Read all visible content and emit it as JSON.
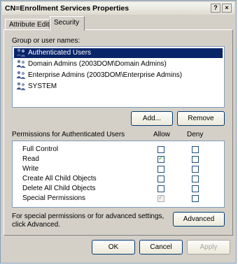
{
  "window": {
    "title": "CN=Enrollment Services Properties",
    "help_glyph": "?",
    "close_glyph": "×"
  },
  "tabs": [
    {
      "label": "Attribute Editor",
      "active": false
    },
    {
      "label": "Security",
      "active": true
    }
  ],
  "security": {
    "group_label": "Group or user names:",
    "users": [
      {
        "name": "Authenticated Users",
        "selected": true,
        "icon": "users-icon"
      },
      {
        "name": "Domain Admins (2003DOM\\Domain Admins)",
        "selected": false,
        "icon": "users-icon"
      },
      {
        "name": "Enterprise Admins (2003DOM\\Enterprise Admins)",
        "selected": false,
        "icon": "users-icon"
      },
      {
        "name": "SYSTEM",
        "selected": false,
        "icon": "users-icon"
      }
    ],
    "add_label": "Add...",
    "remove_label": "Remove",
    "permissions_label": "Permissions for Authenticated Users",
    "allow_label": "Allow",
    "deny_label": "Deny",
    "permissions": [
      {
        "name": "Full Control",
        "allow": false,
        "deny": false
      },
      {
        "name": "Read",
        "allow": true,
        "deny": false
      },
      {
        "name": "Write",
        "allow": false,
        "deny": false
      },
      {
        "name": "Create All Child Objects",
        "allow": false,
        "deny": false
      },
      {
        "name": "Delete All Child Objects",
        "allow": false,
        "deny": false
      },
      {
        "name": "Special Permissions",
        "allow": "disabled-checked",
        "deny": false
      }
    ],
    "special_text_line1": "For special permissions or for advanced settings,",
    "special_text_line2": "click Advanced.",
    "advanced_label": "Advanced"
  },
  "footer": {
    "ok_label": "OK",
    "cancel_label": "Cancel",
    "apply_label": "Apply"
  }
}
